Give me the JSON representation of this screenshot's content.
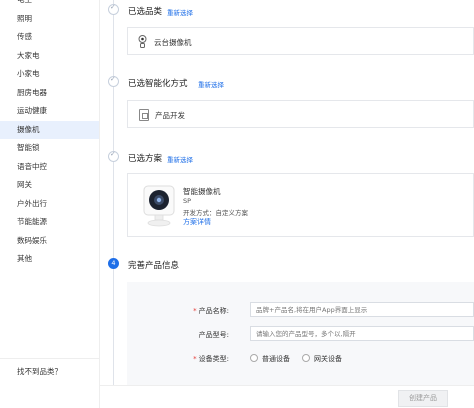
{
  "sidebar": {
    "items": [
      {
        "label": "电工"
      },
      {
        "label": "照明"
      },
      {
        "label": "传感"
      },
      {
        "label": "大家电"
      },
      {
        "label": "小家电"
      },
      {
        "label": "厨房电器"
      },
      {
        "label": "运动健康"
      },
      {
        "label": "摄像机"
      },
      {
        "label": "智能锁"
      },
      {
        "label": "语音中控"
      },
      {
        "label": "网关"
      },
      {
        "label": "户外出行"
      },
      {
        "label": "节能能源"
      },
      {
        "label": "数码娱乐"
      },
      {
        "label": "其他"
      }
    ],
    "active_index": 7,
    "footer": "找不到品类？"
  },
  "steps": {
    "category": {
      "title": "已选品类",
      "reselect": "重新选择",
      "value": "云台摄像机",
      "icon": "camera-icon"
    },
    "method": {
      "title": "已选智能化方式",
      "reselect": "重新选择",
      "value": "产品开发",
      "icon": "document-icon"
    },
    "solution": {
      "title": "已选方案",
      "reselect": "重新选择",
      "name": "智能摄像机",
      "code": "SP",
      "dev_method": "开发方式：自定义方案",
      "details_link": "方案详情"
    },
    "info": {
      "number": "4",
      "title": "完善产品信息"
    }
  },
  "form": {
    "product_name": {
      "label": "产品名称:",
      "required": true,
      "placeholder": "品牌+产品名,将在用户App界面上显示"
    },
    "product_model": {
      "label": "产品型号:",
      "required": false,
      "placeholder": "请输入您的产品型号，多个以,隔开"
    },
    "device_type": {
      "label": "设备类型:",
      "required": true,
      "options": [
        "普通设备",
        "网关设备"
      ]
    }
  },
  "footer": {
    "create_button": "创建产品"
  },
  "colors": {
    "accent": "#1f6fe8",
    "active_bg": "#e8f0fd",
    "required": "#e53935"
  }
}
